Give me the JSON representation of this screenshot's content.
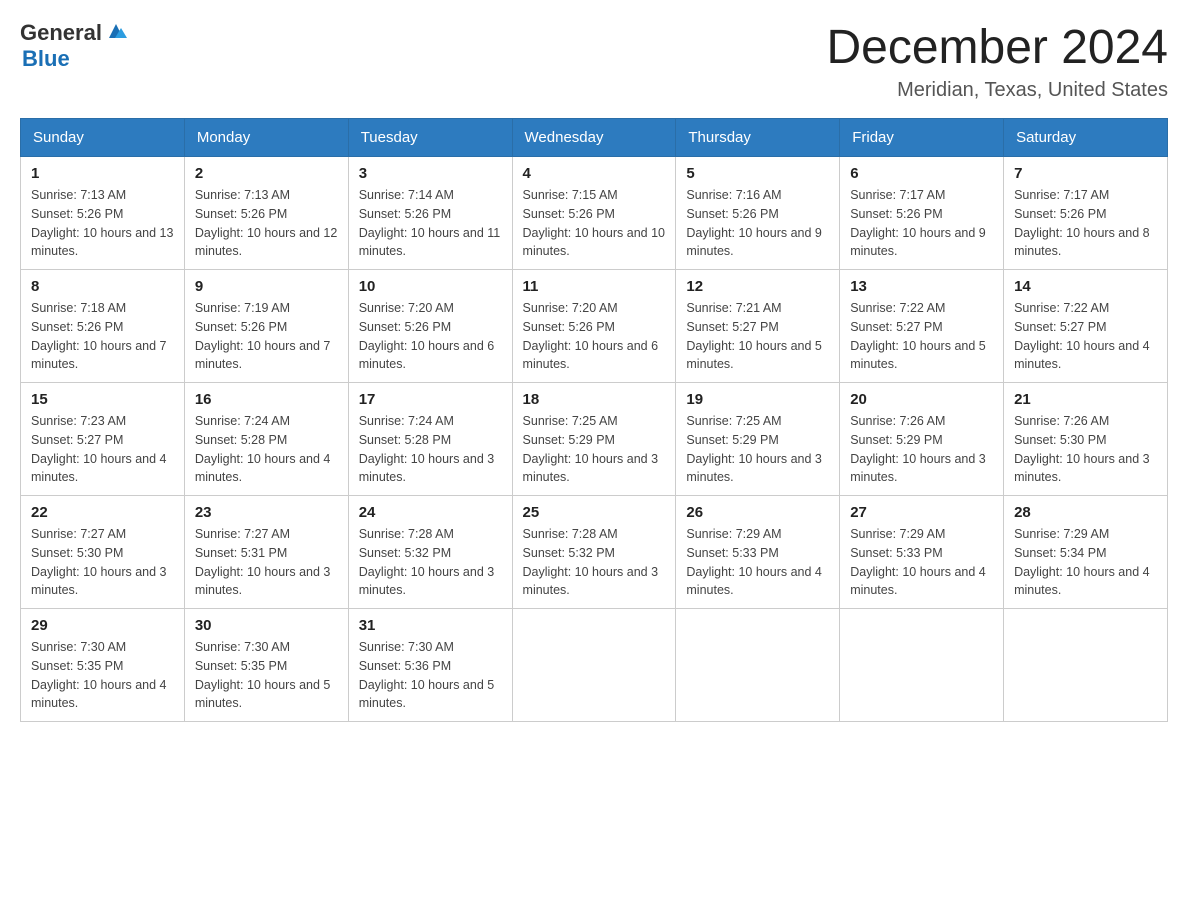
{
  "logo": {
    "text_general": "General",
    "text_blue": "Blue"
  },
  "header": {
    "month": "December 2024",
    "location": "Meridian, Texas, United States"
  },
  "days_of_week": [
    "Sunday",
    "Monday",
    "Tuesday",
    "Wednesday",
    "Thursday",
    "Friday",
    "Saturday"
  ],
  "weeks": [
    [
      {
        "day": "1",
        "sunrise": "7:13 AM",
        "sunset": "5:26 PM",
        "daylight": "10 hours and 13 minutes."
      },
      {
        "day": "2",
        "sunrise": "7:13 AM",
        "sunset": "5:26 PM",
        "daylight": "10 hours and 12 minutes."
      },
      {
        "day": "3",
        "sunrise": "7:14 AM",
        "sunset": "5:26 PM",
        "daylight": "10 hours and 11 minutes."
      },
      {
        "day": "4",
        "sunrise": "7:15 AM",
        "sunset": "5:26 PM",
        "daylight": "10 hours and 10 minutes."
      },
      {
        "day": "5",
        "sunrise": "7:16 AM",
        "sunset": "5:26 PM",
        "daylight": "10 hours and 9 minutes."
      },
      {
        "day": "6",
        "sunrise": "7:17 AM",
        "sunset": "5:26 PM",
        "daylight": "10 hours and 9 minutes."
      },
      {
        "day": "7",
        "sunrise": "7:17 AM",
        "sunset": "5:26 PM",
        "daylight": "10 hours and 8 minutes."
      }
    ],
    [
      {
        "day": "8",
        "sunrise": "7:18 AM",
        "sunset": "5:26 PM",
        "daylight": "10 hours and 7 minutes."
      },
      {
        "day": "9",
        "sunrise": "7:19 AM",
        "sunset": "5:26 PM",
        "daylight": "10 hours and 7 minutes."
      },
      {
        "day": "10",
        "sunrise": "7:20 AM",
        "sunset": "5:26 PM",
        "daylight": "10 hours and 6 minutes."
      },
      {
        "day": "11",
        "sunrise": "7:20 AM",
        "sunset": "5:26 PM",
        "daylight": "10 hours and 6 minutes."
      },
      {
        "day": "12",
        "sunrise": "7:21 AM",
        "sunset": "5:27 PM",
        "daylight": "10 hours and 5 minutes."
      },
      {
        "day": "13",
        "sunrise": "7:22 AM",
        "sunset": "5:27 PM",
        "daylight": "10 hours and 5 minutes."
      },
      {
        "day": "14",
        "sunrise": "7:22 AM",
        "sunset": "5:27 PM",
        "daylight": "10 hours and 4 minutes."
      }
    ],
    [
      {
        "day": "15",
        "sunrise": "7:23 AM",
        "sunset": "5:27 PM",
        "daylight": "10 hours and 4 minutes."
      },
      {
        "day": "16",
        "sunrise": "7:24 AM",
        "sunset": "5:28 PM",
        "daylight": "10 hours and 4 minutes."
      },
      {
        "day": "17",
        "sunrise": "7:24 AM",
        "sunset": "5:28 PM",
        "daylight": "10 hours and 3 minutes."
      },
      {
        "day": "18",
        "sunrise": "7:25 AM",
        "sunset": "5:29 PM",
        "daylight": "10 hours and 3 minutes."
      },
      {
        "day": "19",
        "sunrise": "7:25 AM",
        "sunset": "5:29 PM",
        "daylight": "10 hours and 3 minutes."
      },
      {
        "day": "20",
        "sunrise": "7:26 AM",
        "sunset": "5:29 PM",
        "daylight": "10 hours and 3 minutes."
      },
      {
        "day": "21",
        "sunrise": "7:26 AM",
        "sunset": "5:30 PM",
        "daylight": "10 hours and 3 minutes."
      }
    ],
    [
      {
        "day": "22",
        "sunrise": "7:27 AM",
        "sunset": "5:30 PM",
        "daylight": "10 hours and 3 minutes."
      },
      {
        "day": "23",
        "sunrise": "7:27 AM",
        "sunset": "5:31 PM",
        "daylight": "10 hours and 3 minutes."
      },
      {
        "day": "24",
        "sunrise": "7:28 AM",
        "sunset": "5:32 PM",
        "daylight": "10 hours and 3 minutes."
      },
      {
        "day": "25",
        "sunrise": "7:28 AM",
        "sunset": "5:32 PM",
        "daylight": "10 hours and 3 minutes."
      },
      {
        "day": "26",
        "sunrise": "7:29 AM",
        "sunset": "5:33 PM",
        "daylight": "10 hours and 4 minutes."
      },
      {
        "day": "27",
        "sunrise": "7:29 AM",
        "sunset": "5:33 PM",
        "daylight": "10 hours and 4 minutes."
      },
      {
        "day": "28",
        "sunrise": "7:29 AM",
        "sunset": "5:34 PM",
        "daylight": "10 hours and 4 minutes."
      }
    ],
    [
      {
        "day": "29",
        "sunrise": "7:30 AM",
        "sunset": "5:35 PM",
        "daylight": "10 hours and 4 minutes."
      },
      {
        "day": "30",
        "sunrise": "7:30 AM",
        "sunset": "5:35 PM",
        "daylight": "10 hours and 5 minutes."
      },
      {
        "day": "31",
        "sunrise": "7:30 AM",
        "sunset": "5:36 PM",
        "daylight": "10 hours and 5 minutes."
      },
      null,
      null,
      null,
      null
    ]
  ]
}
